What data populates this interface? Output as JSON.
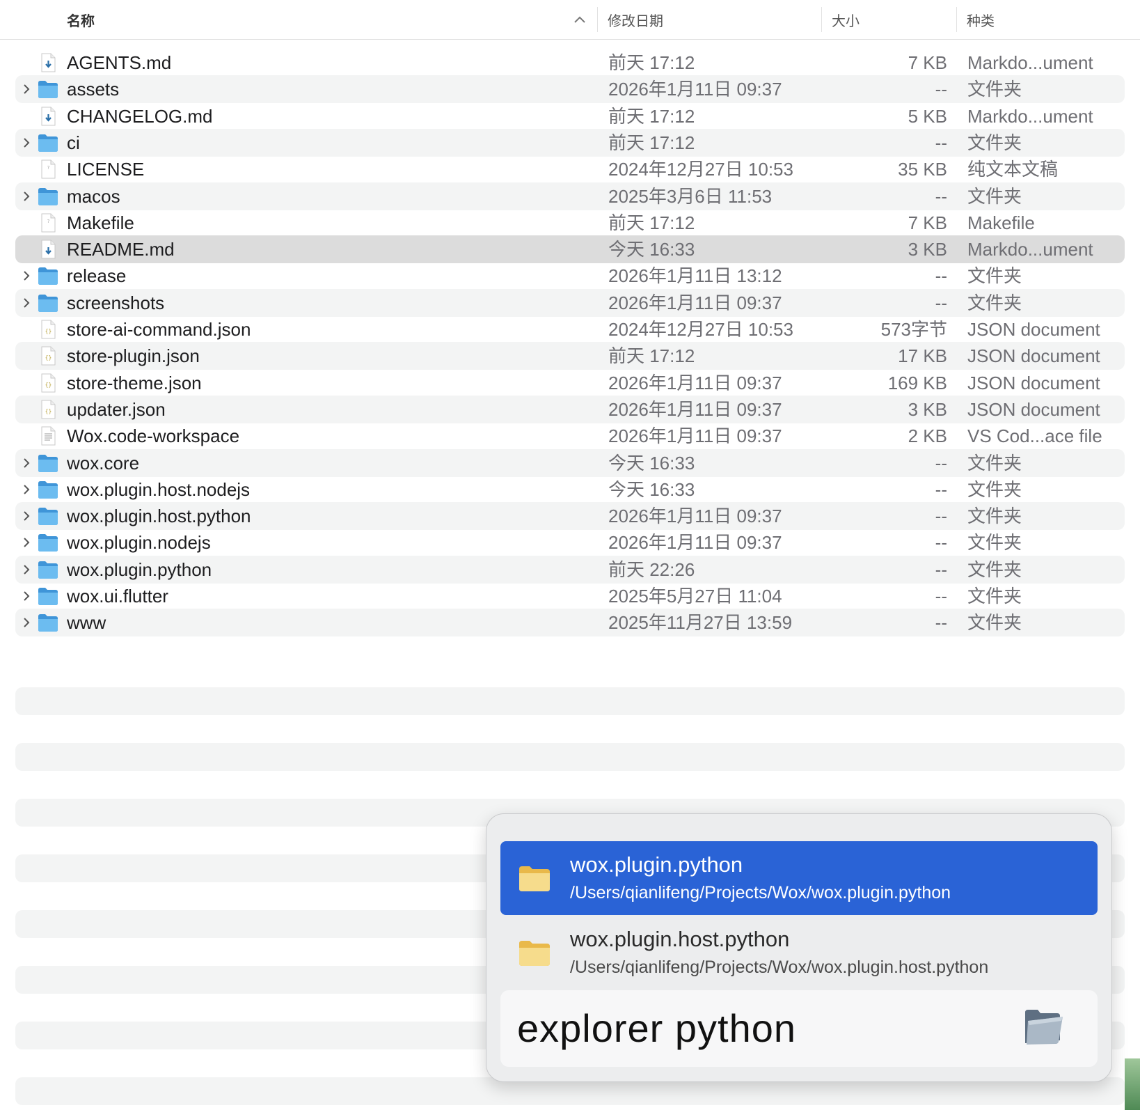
{
  "header": {
    "name": "名称",
    "modified": "修改日期",
    "size": "大小",
    "kind": "种类"
  },
  "rows": [
    {
      "name": "AGENTS.md",
      "date": "前天 17:12",
      "size": "7 KB",
      "kind": "Markdo...ument",
      "type": "markdown"
    },
    {
      "name": "assets",
      "date": "2026年1月11日 09:37",
      "size": "--",
      "kind": "文件夹",
      "type": "folder"
    },
    {
      "name": "CHANGELOG.md",
      "date": "前天 17:12",
      "size": "5 KB",
      "kind": "Markdo...ument",
      "type": "markdown"
    },
    {
      "name": "ci",
      "date": "前天 17:12",
      "size": "--",
      "kind": "文件夹",
      "type": "folder"
    },
    {
      "name": "LICENSE",
      "date": "2024年12月27日 10:53",
      "size": "35 KB",
      "kind": "纯文本文稿",
      "type": "plain"
    },
    {
      "name": "macos",
      "date": "2025年3月6日 11:53",
      "size": "--",
      "kind": "文件夹",
      "type": "folder"
    },
    {
      "name": "Makefile",
      "date": "前天 17:12",
      "size": "7 KB",
      "kind": "Makefile",
      "type": "plain"
    },
    {
      "name": "README.md",
      "date": "今天 16:33",
      "size": "3 KB",
      "kind": "Markdo...ument",
      "type": "markdown",
      "selected": true
    },
    {
      "name": "release",
      "date": "2026年1月11日 13:12",
      "size": "--",
      "kind": "文件夹",
      "type": "folder"
    },
    {
      "name": "screenshots",
      "date": "2026年1月11日 09:37",
      "size": "--",
      "kind": "文件夹",
      "type": "folder"
    },
    {
      "name": "store-ai-command.json",
      "date": "2024年12月27日 10:53",
      "size": "573字节",
      "kind": "JSON document",
      "type": "json"
    },
    {
      "name": "store-plugin.json",
      "date": "前天 17:12",
      "size": "17 KB",
      "kind": "JSON document",
      "type": "json"
    },
    {
      "name": "store-theme.json",
      "date": "2026年1月11日 09:37",
      "size": "169 KB",
      "kind": "JSON document",
      "type": "json"
    },
    {
      "name": "updater.json",
      "date": "2026年1月11日 09:37",
      "size": "3 KB",
      "kind": "JSON document",
      "type": "json"
    },
    {
      "name": "Wox.code-workspace",
      "date": "2026年1月11日 09:37",
      "size": "2 KB",
      "kind": "VS Cod...ace file",
      "type": "text"
    },
    {
      "name": "wox.core",
      "date": "今天 16:33",
      "size": "--",
      "kind": "文件夹",
      "type": "folder"
    },
    {
      "name": "wox.plugin.host.nodejs",
      "date": "今天 16:33",
      "size": "--",
      "kind": "文件夹",
      "type": "folder"
    },
    {
      "name": "wox.plugin.host.python",
      "date": "2026年1月11日 09:37",
      "size": "--",
      "kind": "文件夹",
      "type": "folder"
    },
    {
      "name": "wox.plugin.nodejs",
      "date": "2026年1月11日 09:37",
      "size": "--",
      "kind": "文件夹",
      "type": "folder"
    },
    {
      "name": "wox.plugin.python",
      "date": "前天 22:26",
      "size": "--",
      "kind": "文件夹",
      "type": "folder"
    },
    {
      "name": "wox.ui.flutter",
      "date": "2025年5月27日 11:04",
      "size": "--",
      "kind": "文件夹",
      "type": "folder"
    },
    {
      "name": "www",
      "date": "2025年11月27日 13:59",
      "size": "--",
      "kind": "文件夹",
      "type": "folder"
    }
  ],
  "launcher": {
    "results": [
      {
        "title": "wox.plugin.python",
        "subtitle": "/Users/qianlifeng/Projects/Wox/wox.plugin.python",
        "active": true
      },
      {
        "title": "wox.plugin.host.python",
        "subtitle": "/Users/qianlifeng/Projects/Wox/wox.plugin.host.python",
        "active": false
      }
    ],
    "query": "explorer python"
  },
  "colors": {
    "accent": "#2a63d6",
    "folder_blue": "#5aaee8",
    "folder_yellow": "#f3d37a",
    "alt_row": "#f3f4f4",
    "selected_row": "#dcdcdc"
  },
  "icons": {
    "folder": "folder-icon",
    "markdown": "markdown-file-icon",
    "plain": "plain-file-icon",
    "json": "json-file-icon",
    "text": "text-file-icon",
    "sort": "chevron-up-icon",
    "expand": "chevron-right-icon",
    "launcher_result": "folder-icon",
    "query": "open-folder-icon"
  }
}
